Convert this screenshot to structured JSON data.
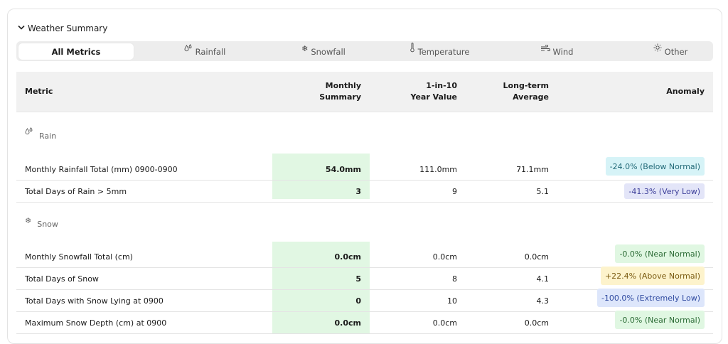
{
  "summary": {
    "title": "Weather Summary"
  },
  "tabs": [
    {
      "label": "All Metrics",
      "icon": ""
    },
    {
      "label": "Rainfall",
      "icon": "raindrops-icon"
    },
    {
      "label": "Snowfall",
      "icon": "snowflake-icon"
    },
    {
      "label": "Temperature",
      "icon": "thermometer-icon"
    },
    {
      "label": "Wind",
      "icon": "wind-icon"
    },
    {
      "label": "Other",
      "icon": "sun-icon"
    }
  ],
  "table": {
    "headers": {
      "metric": "Metric",
      "monthly_line1": "Monthly",
      "monthly_line2": "Summary",
      "oneinten_line1": "1-in-10",
      "oneinten_line2": "Year Value",
      "avg_line1": "Long-term",
      "avg_line2": "Average",
      "anomaly": "Anomaly"
    },
    "sections": [
      {
        "label": "Rain",
        "icon": "raindrops-icon",
        "rows": [
          {
            "metric": "Monthly Rainfall Total (mm) 0900-0900",
            "monthly": "54.0mm",
            "one_in_ten": "111.0mm",
            "average": "71.1mm",
            "anomaly": "-24.0% (Below Normal)"
          },
          {
            "metric": "Total Days of Rain > 5mm",
            "monthly": "3",
            "one_in_ten": "9",
            "average": "5.1",
            "anomaly": "-41.3% (Very Low)"
          }
        ]
      },
      {
        "label": "Snow",
        "icon": "snowflake-icon",
        "rows": [
          {
            "metric": "Monthly Snowfall Total (cm)",
            "monthly": "0.0cm",
            "one_in_ten": "0.0cm",
            "average": "0.0cm",
            "anomaly": "-0.0% (Near Normal)"
          },
          {
            "metric": "Total Days of Snow",
            "monthly": "5",
            "one_in_ten": "8",
            "average": "4.1",
            "anomaly": "+22.4% (Above Normal)"
          },
          {
            "metric": "Total Days with Snow Lying at 0900",
            "monthly": "0",
            "one_in_ten": "10",
            "average": "4.3",
            "anomaly": "-100.0% (Extremely Low)"
          },
          {
            "metric": "Maximum Snow Depth (cm) at 0900",
            "monthly": "0.0cm",
            "one_in_ten": "0.0cm",
            "average": "0.0cm",
            "anomaly": "-0.0% (Near Normal)"
          }
        ]
      }
    ]
  },
  "colors": {
    "monthly_column_bg": "#e1f7e3",
    "below_normal_bg": "#d6f3f7",
    "very_low_bg": "#e3e5f8",
    "near_normal_bg": "#e0f7e2",
    "above_normal_bg": "#fdf3cc",
    "extremely_low_bg": "#dde6fb"
  }
}
